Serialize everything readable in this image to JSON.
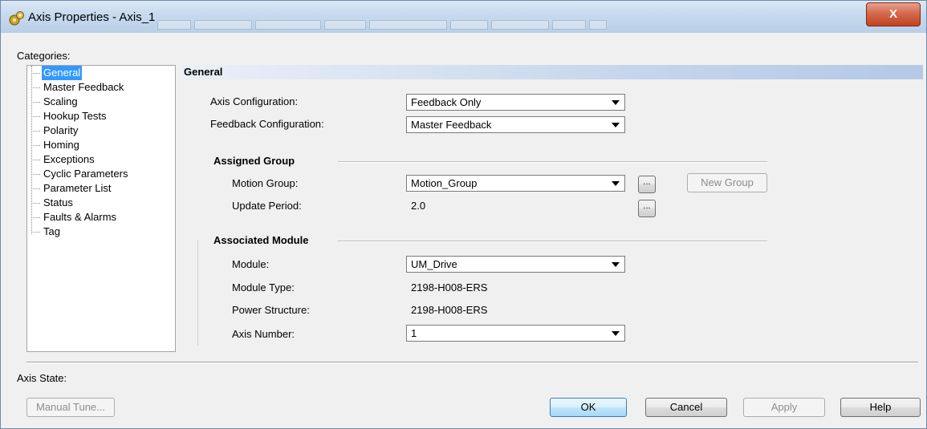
{
  "window": {
    "title": "Axis Properties - Axis_1",
    "close_label": "X",
    "icon": "gear-axis-icon"
  },
  "categories": {
    "label": "Categories:",
    "items": [
      {
        "label": "General",
        "selected": true
      },
      {
        "label": "Master Feedback"
      },
      {
        "label": "Scaling"
      },
      {
        "label": "Hookup Tests"
      },
      {
        "label": "Polarity"
      },
      {
        "label": "Homing"
      },
      {
        "label": "Exceptions"
      },
      {
        "label": "Cyclic Parameters"
      },
      {
        "label": "Parameter List"
      },
      {
        "label": "Status"
      },
      {
        "label": "Faults & Alarms"
      },
      {
        "label": "Tag"
      }
    ]
  },
  "general": {
    "header": "General",
    "axis_configuration": {
      "label": "Axis Configuration:",
      "value": "Feedback Only"
    },
    "feedback_configuration": {
      "label": "Feedback Configuration:",
      "value": "Master Feedback"
    },
    "assigned_group": {
      "title": "Assigned Group",
      "motion_group": {
        "label": "Motion Group:",
        "value": "Motion_Group"
      },
      "update_period": {
        "label": "Update Period:",
        "value": "2.0"
      },
      "ellipsis": "...",
      "new_group": "New Group"
    },
    "associated_module": {
      "title": "Associated Module",
      "module": {
        "label": "Module:",
        "value": "UM_Drive"
      },
      "module_type": {
        "label": "Module Type:",
        "value": "2198-H008-ERS"
      },
      "power_structure": {
        "label": "Power Structure:",
        "value": "2198-H008-ERS"
      },
      "axis_number": {
        "label": "Axis Number:",
        "value": "1"
      }
    }
  },
  "footer": {
    "axis_state_label": "Axis State:",
    "manual_tune": "Manual Tune...",
    "ok": "OK",
    "cancel": "Cancel",
    "apply": "Apply",
    "help": "Help"
  }
}
